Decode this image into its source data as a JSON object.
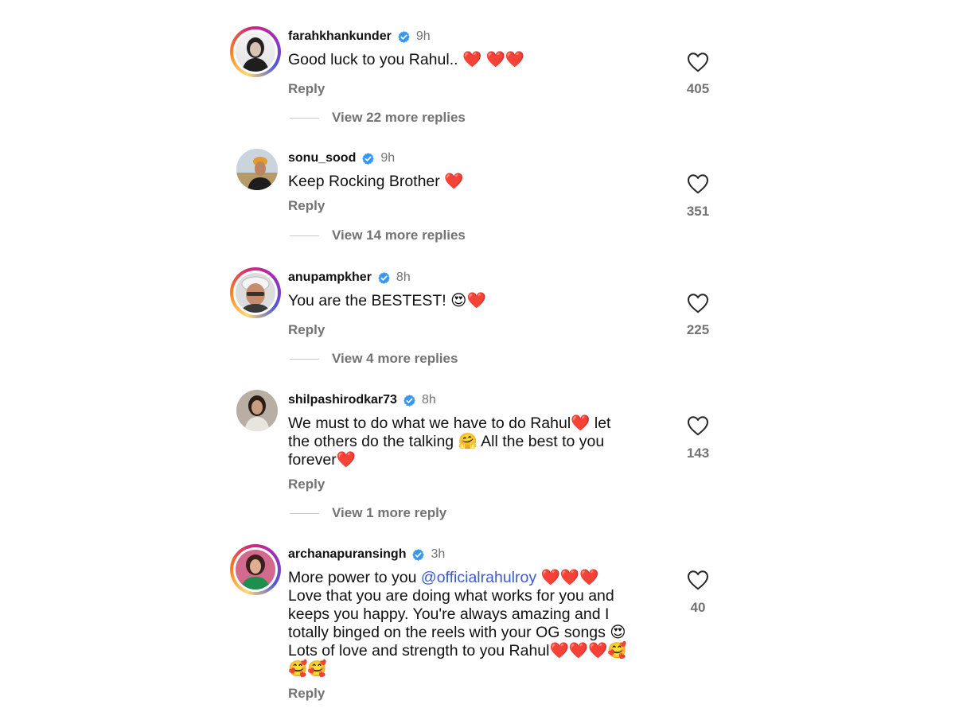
{
  "comments": [
    {
      "username": "farahkhankunder",
      "time": "9h",
      "text": "Good luck to you Rahul.. ❤️ ❤️❤️",
      "reply_label": "Reply",
      "likes": "405",
      "view_replies": "View 22 more replies"
    },
    {
      "username": "sonu_sood",
      "time": "9h",
      "text": "Keep Rocking Brother ❤️",
      "reply_label": "Reply",
      "likes": "351",
      "view_replies": "View 14 more replies"
    },
    {
      "username": "anupampkher",
      "time": "8h",
      "text": "You are the BESTEST! 😍❤️",
      "reply_label": "Reply",
      "likes": "225",
      "view_replies": "View 4 more replies"
    },
    {
      "username": "shilpashirodkar73",
      "time": "8h",
      "text_lines": [
        "We must to do what we have to do Rahul❤️ let",
        "the others do the talking 🤗 All the best to you",
        "forever❤️"
      ],
      "reply_label": "Reply",
      "likes": "143",
      "view_replies": "View 1 more reply"
    },
    {
      "username": "archanapuransingh",
      "time": "3h",
      "text_prefix": "More power to you ",
      "mention": "@officialrahulroy",
      "text_suffix": " ❤️❤️❤️",
      "text_lines": [
        "Love that you are doing what works for you and",
        "keeps you happy. You're always amazing and I",
        "totally binged on the reels with your OG songs 😍",
        "Lots of love and strength to you Rahul❤️❤️❤️🥰",
        "🥰🥰"
      ],
      "reply_label": "Reply",
      "likes": "40"
    }
  ],
  "colors": {
    "verified": "#3897f0",
    "secondary_text": "#737373",
    "mention": "#3a5cc5",
    "heart_emoji": "#e0182b"
  }
}
